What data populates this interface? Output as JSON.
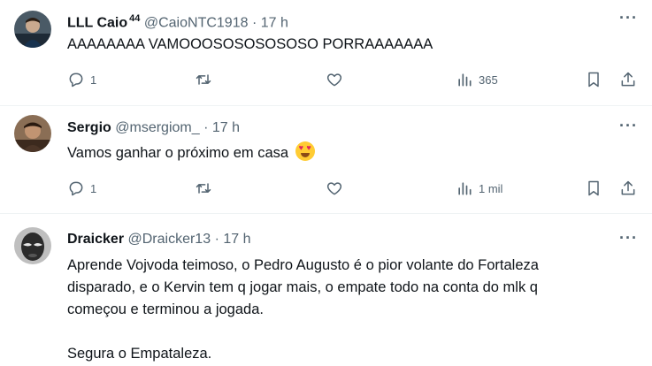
{
  "tweets": [
    {
      "name": "LLL Caio",
      "badge": "44",
      "handle": "@CaioNTC1918",
      "separator": "·",
      "time": "17 h",
      "text": "AAAAAAAA VAMOOOSOSOSOSOSO PORRAAAAAAA",
      "replies": "1",
      "retweets": "",
      "likes": "",
      "views": "365",
      "avatar_color": "#1e2a36"
    },
    {
      "name": "Sergio",
      "handle": "@msergiom_",
      "separator": "·",
      "time": "17 h",
      "text": "Vamos ganhar o próximo em casa",
      "emoji": "smiling-face-with-heart-eyes",
      "replies": "1",
      "retweets": "",
      "likes": "",
      "views": "1 mil",
      "avatar_color": "#6b4a32"
    },
    {
      "name": "Draicker",
      "handle": "@Draicker13",
      "separator": "·",
      "time": "17 h",
      "text_lines": [
        "Aprende Vojvoda teimoso, o Pedro Augusto é o pior volante do Fortaleza",
        "disparado, e o Kervin tem q jogar mais, o empate todo na conta do mlk q",
        "começou e terminou a jogada."
      ],
      "text_last": "Segura o Empataleza.",
      "avatar_color": "#2b2b2b"
    }
  ],
  "more_label": "···",
  "colors": {
    "text": "#0f1419",
    "muted": "#536471",
    "divider": "#eff3f4"
  }
}
